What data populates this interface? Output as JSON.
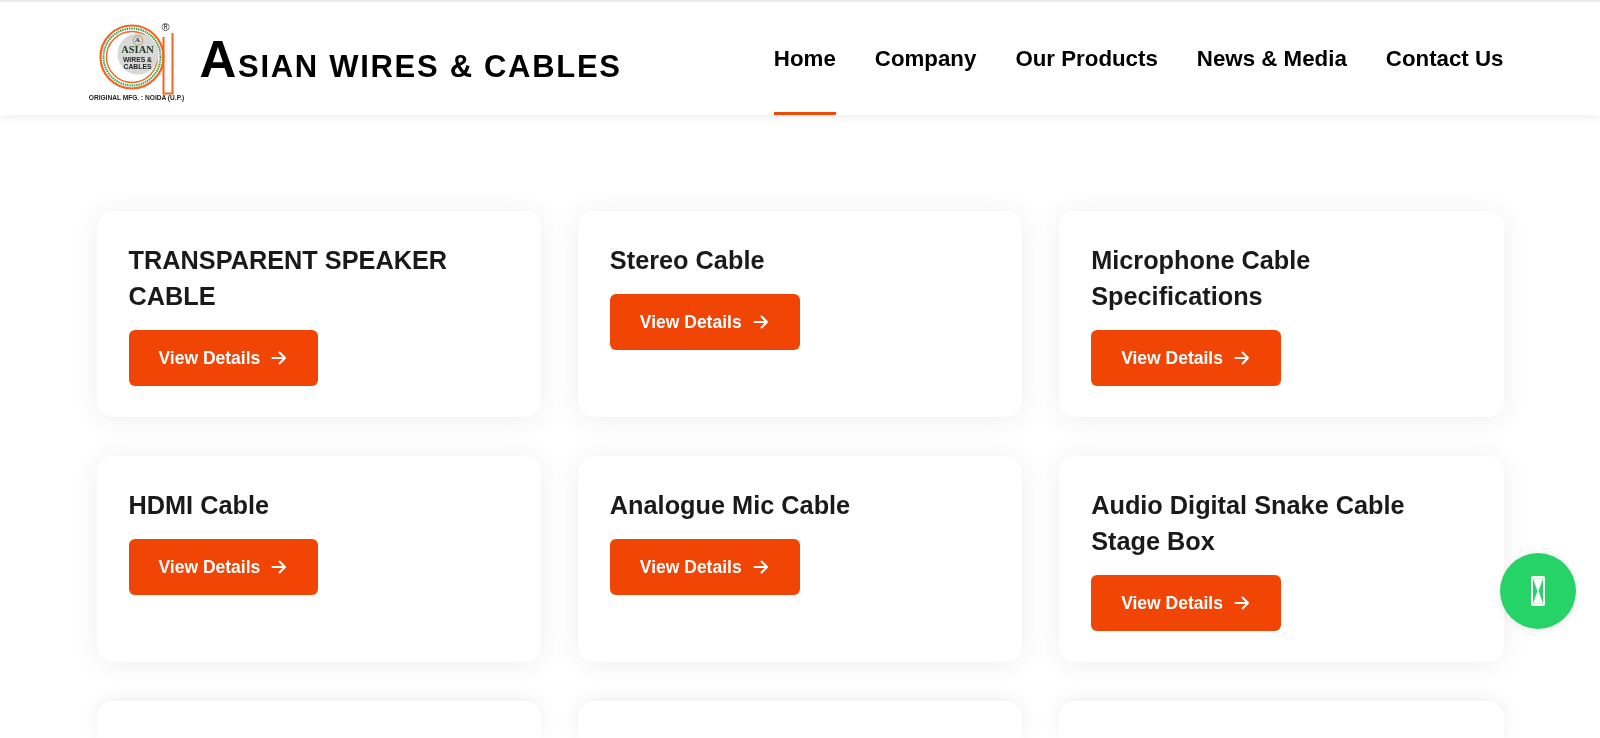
{
  "header": {
    "logo": {
      "registered_mark": "®",
      "emblem_letter": "A",
      "emblem_name": "ASIAN",
      "emblem_tagline": "WIRES & CABLES",
      "origin": "ORIGINAL MFG. : NOIDA (U.P.)"
    },
    "brand": "ASIAN WIRES & CABLES",
    "nav": [
      {
        "label": "Home",
        "selected": true
      },
      {
        "label": "Company",
        "selected": false
      },
      {
        "label": "Our Products",
        "selected": false
      },
      {
        "label": "News & Media",
        "selected": false
      },
      {
        "label": "Contact Us",
        "selected": false
      }
    ]
  },
  "products": [
    {
      "kind": "product",
      "title": "TRANSPARENT SPEAKER CABLE",
      "button": "View Details"
    },
    {
      "kind": "product",
      "title": "Stereo Cable",
      "button": "View Details"
    },
    {
      "kind": "product",
      "title": "Microphone Cable Specifications",
      "button": "View Details"
    },
    {
      "kind": "product",
      "title": "HDMI Cable",
      "button": "View Details"
    },
    {
      "kind": "product",
      "title": "Analogue Mic Cable",
      "button": "View Details"
    },
    {
      "kind": "product",
      "title": "Audio Digital Snake Cable Stage Box",
      "button": "View Details"
    },
    {
      "kind": "cut_off"
    },
    {
      "kind": "cut_off"
    },
    {
      "kind": "cut_off"
    }
  ]
}
